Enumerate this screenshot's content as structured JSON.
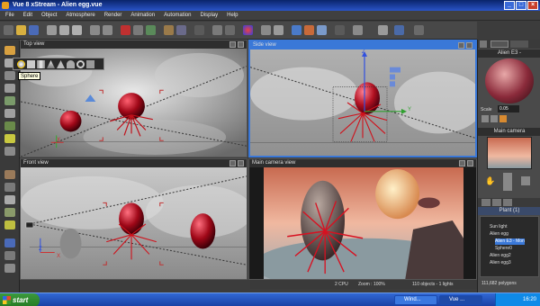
{
  "window": {
    "title": "Vue 8 xStream - Alien egg.vue"
  },
  "menu": [
    "File",
    "Edit",
    "Object",
    "Atmosphere",
    "Render",
    "Animation",
    "Automation",
    "Display",
    "Help"
  ],
  "viewports": {
    "top": {
      "label": "Top view"
    },
    "side": {
      "label": "Side view"
    },
    "front": {
      "label": "Front view"
    },
    "camera": {
      "label": "Main camera view"
    }
  },
  "tooltip": "Sphere",
  "axes": {
    "x": "X",
    "y": "Y",
    "z": "Z"
  },
  "right_panel": {
    "object_name": "Alien E3 -",
    "scale_label": "Scale",
    "scale_value": "0.05",
    "camera_title": "Main camera",
    "layer_title": "Plant (1)",
    "tree": [
      "Sun light",
      "Alien egg",
      "Alien E3 - Mon",
      "Sphere0",
      "Alien egg2",
      "Alien egg3"
    ],
    "polygons": "111,682 polygons"
  },
  "status": {
    "cpu": "2 CPU",
    "zoom": "Zoom : 100%",
    "objects": "110 objects - 1 lights"
  },
  "taskbar": {
    "start": "start",
    "items": [
      "Wind...",
      "Vue ..."
    ],
    "clock": "16:20"
  },
  "colors": {
    "accent": "#3a78d8",
    "title_bar": "#0a246a",
    "alien_red": "#c8102a"
  }
}
